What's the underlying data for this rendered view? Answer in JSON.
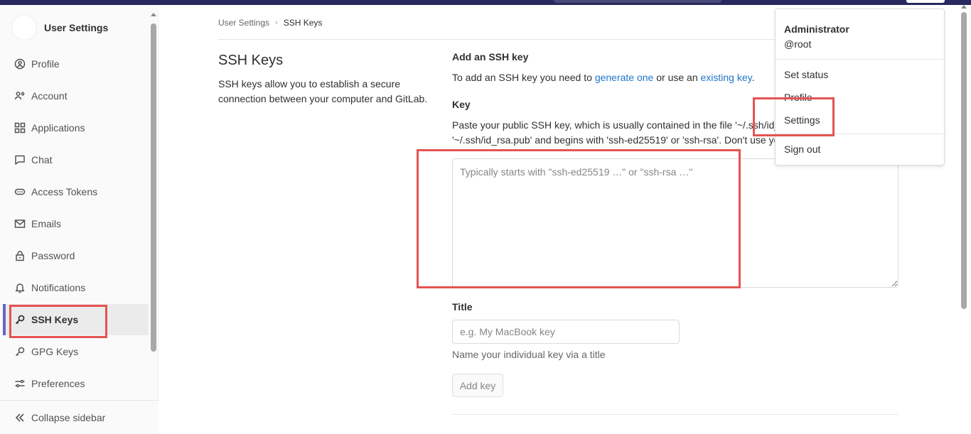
{
  "sidebar": {
    "title": "User Settings",
    "items": [
      {
        "label": "Profile",
        "icon": "profile-icon"
      },
      {
        "label": "Account",
        "icon": "account-icon"
      },
      {
        "label": "Applications",
        "icon": "applications-icon"
      },
      {
        "label": "Chat",
        "icon": "chat-icon"
      },
      {
        "label": "Access Tokens",
        "icon": "token-icon"
      },
      {
        "label": "Emails",
        "icon": "mail-icon"
      },
      {
        "label": "Password",
        "icon": "lock-icon"
      },
      {
        "label": "Notifications",
        "icon": "bell-icon"
      },
      {
        "label": "SSH Keys",
        "icon": "key-icon"
      },
      {
        "label": "GPG Keys",
        "icon": "key-icon"
      },
      {
        "label": "Preferences",
        "icon": "preferences-icon"
      }
    ],
    "collapse_label": "Collapse sidebar"
  },
  "breadcrumb": {
    "parent": "User Settings",
    "separator": "›",
    "current": "SSH Keys"
  },
  "main": {
    "title": "SSH Keys",
    "description": "SSH keys allow you to establish a secure connection between your computer and GitLab.",
    "add_title": "Add an SSH key",
    "help_prefix": "To add an SSH key you need to ",
    "help_link1": "generate one",
    "help_middle": " or use an ",
    "help_link2": "existing key",
    "help_suffix": ".",
    "key_label": "Key",
    "key_help_line1": "Paste your public SSH key, which is usually contained in the file '~/.ssh/id_",
    "key_help_line2": "'~/.ssh/id_rsa.pub' and begins with 'ssh-ed25519' or 'ssh-rsa'. Don't use yo",
    "key_placeholder": "Typically starts with \"ssh-ed25519 …\" or \"ssh-rsa …\"",
    "title_label": "Title",
    "title_placeholder": "e.g. My MacBook key",
    "title_help": "Name your individual key via a title",
    "add_button": "Add key"
  },
  "dropdown": {
    "name": "Administrator",
    "username": "@root",
    "items": [
      "Set status",
      "Profile",
      "Settings",
      "Sign out"
    ]
  },
  "colors": {
    "navbar": "#292961",
    "active_accent": "#6666c4",
    "link": "#1f75cb",
    "annotation": "#e55353"
  }
}
